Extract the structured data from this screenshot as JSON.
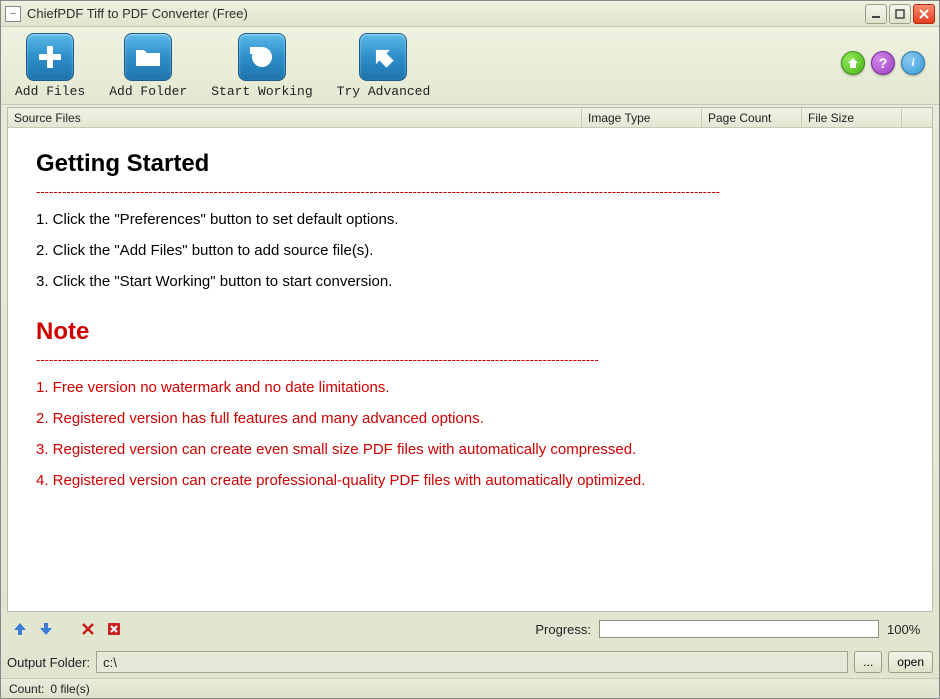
{
  "window": {
    "title": "ChiefPDF Tiff to PDF Converter (Free)"
  },
  "toolbar": {
    "add_files": "Add Files",
    "add_folder": "Add Folder",
    "start_working": "Start Working",
    "try_advanced": "Try Advanced"
  },
  "table": {
    "headers": {
      "source": "Source Files",
      "image_type": "Image Type",
      "page_count": "Page Count",
      "file_size": "File Size"
    }
  },
  "content": {
    "getting_started_title": "Getting Started",
    "dashes": "--------------------------------------------------------------------------------------------------------------------------------------------------------------",
    "steps": [
      "1. Click the \"Preferences\" button to set default options.",
      "2. Click the \"Add Files\" button to add source file(s).",
      "3. Click the \"Start Working\" button to start conversion."
    ],
    "note_title": "Note",
    "note_dashes": "----------------------------------------------------------------------------------------------------------------------------------",
    "notes": [
      "1. Free version no watermark and no date limitations.",
      "2. Registered version has full features and many advanced options.",
      "3. Registered version can create even small size PDF files with automatically compressed.",
      "4. Registered version can create professional-quality PDF files with automatically optimized."
    ]
  },
  "progress": {
    "label": "Progress:",
    "percent": "100%"
  },
  "output": {
    "label": "Output Folder:",
    "path": "c:\\",
    "browse": "...",
    "open": "open"
  },
  "status": {
    "count_label": "Count:",
    "count_value": "0 file(s)"
  }
}
